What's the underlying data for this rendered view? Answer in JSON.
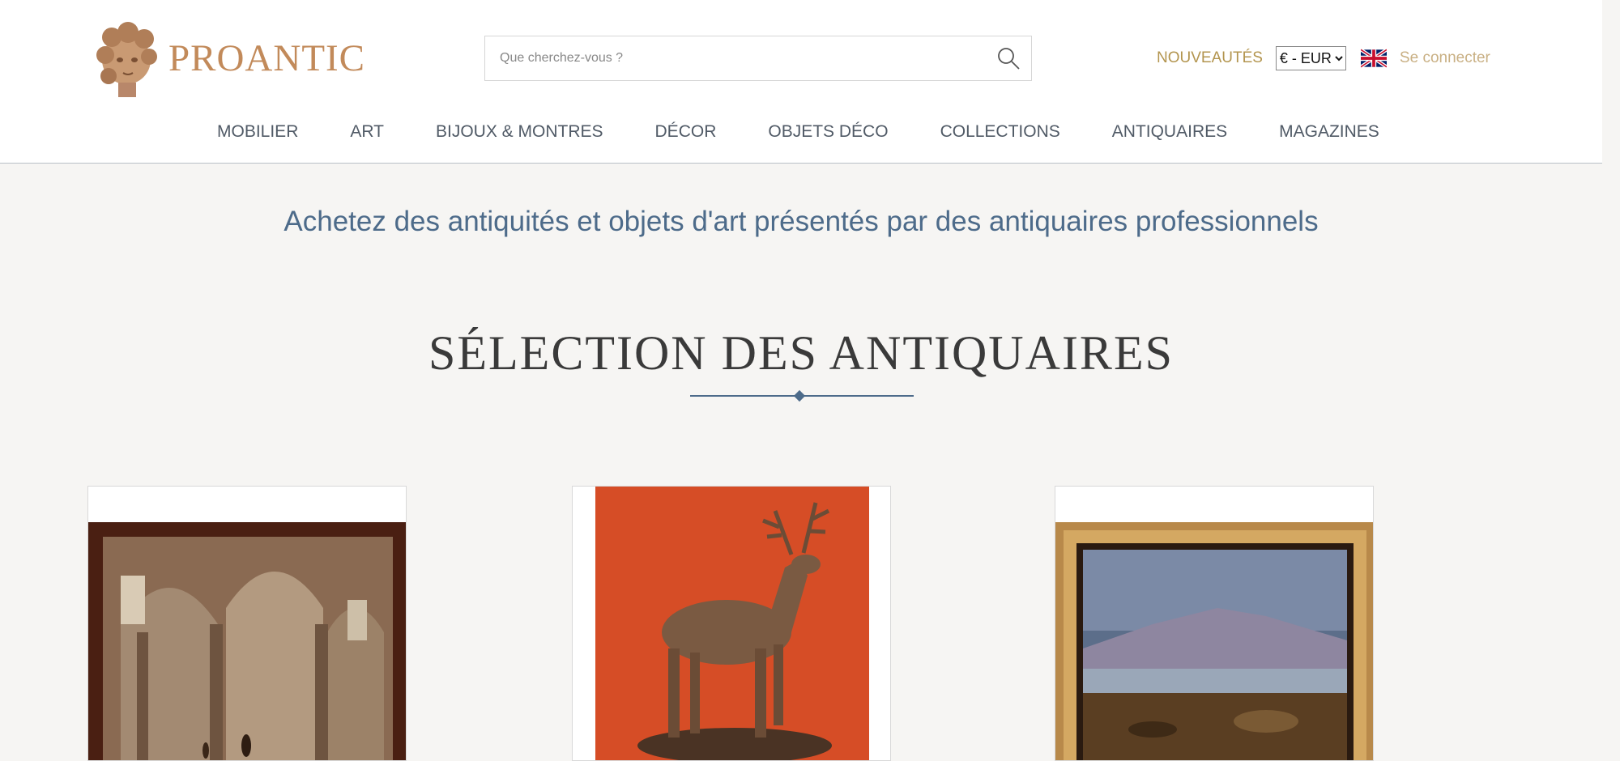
{
  "brand": {
    "name": "PROANTIC"
  },
  "search": {
    "placeholder": "Que cherchez-vous ?"
  },
  "header": {
    "new_label": "NOUVEAUTÉS",
    "currency": {
      "selected": "€ - EUR",
      "options": [
        "€ - EUR"
      ]
    },
    "language_flag": "uk-flag-icon",
    "login_label": "Se connecter"
  },
  "nav": {
    "items": [
      "MOBILIER",
      "ART",
      "BIJOUX & MONTRES",
      "DÉCOR",
      "OBJETS DÉCO",
      "COLLECTIONS",
      "ANTIQUAIRES",
      "MAGAZINES"
    ]
  },
  "main": {
    "tagline": "Achetez des antiquités et objets d'art présentés par des antiquaires professionnels",
    "section_title": "SÉLECTION DES ANTIQUAIRES"
  },
  "products": [
    {
      "image": "church-interior-painting"
    },
    {
      "image": "bronze-stag-sculpture"
    },
    {
      "image": "landscape-painting"
    }
  ],
  "colors": {
    "brand": "#c28a5a",
    "accent_gold": "#b3954f",
    "nav_text": "#505a66",
    "tagline": "#4d6b8a",
    "background": "#f6f5f3"
  }
}
